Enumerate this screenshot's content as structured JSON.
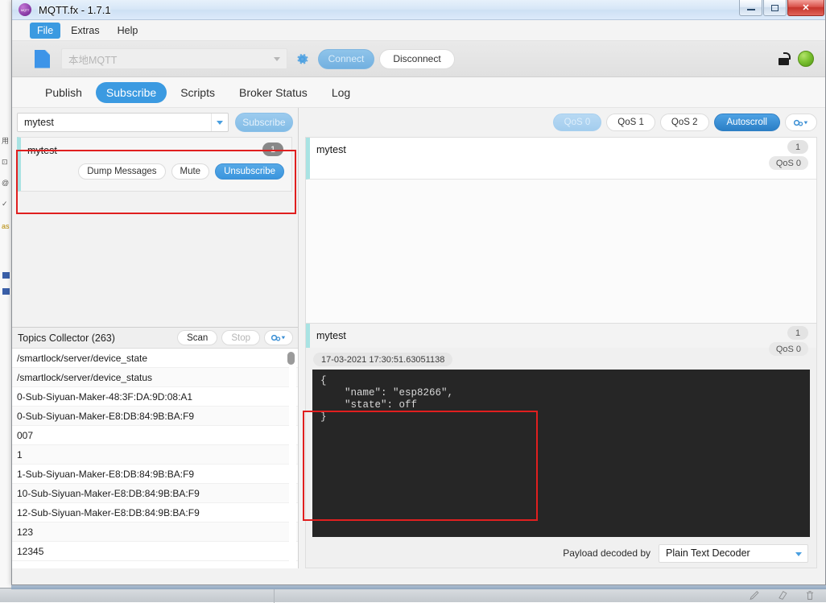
{
  "window": {
    "title": "MQTT.fx - 1.7.1",
    "app_icon": "mqtt-logo-icon",
    "minimize": "minimize-icon",
    "maximize": "maximize-icon",
    "close": "✕"
  },
  "menu": {
    "items": [
      {
        "label": "File",
        "active": true
      },
      {
        "label": "Extras",
        "active": false
      },
      {
        "label": "Help",
        "active": false
      }
    ]
  },
  "toolbar": {
    "profile_placeholder": "本地MQTT",
    "profile_value": "",
    "settings_icon": "gear-icon",
    "connect_label": "Connect",
    "disconnect_label": "Disconnect",
    "lock_icon": "unlocked-padlock-icon",
    "status_indicator": "connected-green-dot",
    "status_color": "#7dc332"
  },
  "tabs": [
    {
      "label": "Publish",
      "active": false
    },
    {
      "label": "Subscribe",
      "active": true
    },
    {
      "label": "Scripts",
      "active": false
    },
    {
      "label": "Broker Status",
      "active": false
    },
    {
      "label": "Log",
      "active": false
    }
  ],
  "subscribe": {
    "topic_value": "mytest",
    "topic_placeholder": "",
    "subscribe_button": "Subscribe",
    "subscription": {
      "topic": "mytest",
      "count": "1",
      "dump_messages_label": "Dump Messages",
      "mute_label": "Mute",
      "unsubscribe_label": "Unsubscribe"
    }
  },
  "qos_bar": {
    "qos0": "QoS 0",
    "qos1": "QoS 1",
    "qos2": "QoS 2",
    "autoscroll": "Autoscroll",
    "options_icon": "gears-dropdown-icon"
  },
  "topics_collector": {
    "title": "Topics Collector (263)",
    "scan_label": "Scan",
    "stop_label": "Stop",
    "options_icon": "gears-dropdown-icon",
    "topics": [
      "/smartlock/server/device_state",
      "/smartlock/server/device_status",
      "0-Sub-Siyuan-Maker-48:3F:DA:9D:08:A1",
      "0-Sub-Siyuan-Maker-E8:DB:84:9B:BA:F9",
      "007",
      "1",
      "1-Sub-Siyuan-Maker-E8:DB:84:9B:BA:F9",
      "10-Sub-Siyuan-Maker-E8:DB:84:9B:BA:F9",
      "12-Sub-Siyuan-Maker-E8:DB:84:9B:BA:F9",
      "123",
      "12345"
    ]
  },
  "message_list": [
    {
      "topic": "mytest",
      "count": "1",
      "qos": "QoS 0"
    }
  ],
  "payload": {
    "topic": "mytest",
    "count": "1",
    "qos": "QoS 0",
    "timestamp": "17-03-2021  17:30:51.63051138",
    "body": "{\n    \"name\": \"esp8266\",\n    \"state\": off\n}",
    "decoder_label": "Payload decoded by",
    "decoder_value": "Plain Text Decoder"
  },
  "annotations": {
    "highlight_color": "#e01f1f",
    "subscription_box": "red-highlight-subscription",
    "payload_box": "red-highlight-payload"
  }
}
